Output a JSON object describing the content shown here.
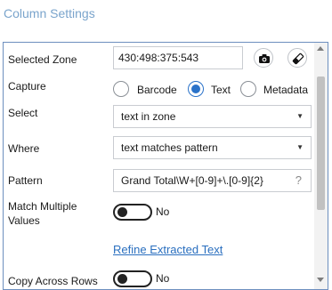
{
  "header": {
    "title": "Column Settings"
  },
  "selected_zone": {
    "label": "Selected Zone",
    "value": "430:498:375:543"
  },
  "capture": {
    "label": "Capture",
    "options": [
      {
        "label": "Barcode",
        "checked": false
      },
      {
        "label": "Text",
        "checked": true
      },
      {
        "label": "Metadata",
        "checked": false
      }
    ]
  },
  "select": {
    "label": "Select",
    "value": "text in zone"
  },
  "where": {
    "label": "Where",
    "value": "text matches pattern"
  },
  "pattern": {
    "label": "Pattern",
    "value": "Grand Total\\W+[0-9]+\\.[0-9]{2}",
    "help": "?"
  },
  "match_multiple": {
    "label_line1": "Match Multiple",
    "label_line2": "Values",
    "state": "No"
  },
  "refine_link": "Refine Extracted Text",
  "copy_across": {
    "label": "Copy Across Rows",
    "state": "No"
  },
  "icons": {
    "capture_button": "camera-icon",
    "clear_button": "eraser-icon"
  },
  "colors": {
    "accent": "#2a72c9",
    "title": "#7aa4cc",
    "link": "#2a6fbf"
  }
}
